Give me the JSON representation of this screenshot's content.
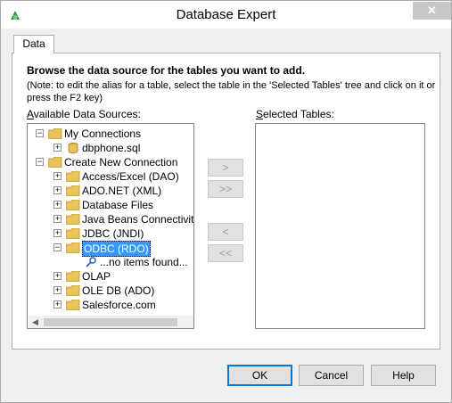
{
  "window": {
    "title": "Database Expert",
    "close_glyph": "✕"
  },
  "tabs": [
    {
      "label": "Data"
    }
  ],
  "heading": "Browse the data source for the tables you want to add.",
  "note": "(Note: to edit the alias for a table, select the table in the 'Selected Tables' tree and click on it or press the F2 key)",
  "available": {
    "label_prefix": "A",
    "label_rest": "vailable Data Sources:"
  },
  "selected": {
    "label_prefix": "S",
    "label_rest": "elected Tables:"
  },
  "tree": {
    "items": [
      {
        "label": "My Connections",
        "expander": "−",
        "icon": "folder-icon"
      },
      {
        "label": "dbphone.sql",
        "expander": "+",
        "icon": "database-icon"
      },
      {
        "label": "Create New Connection",
        "expander": "−",
        "icon": "folder-icon"
      },
      {
        "label": "Access/Excel (DAO)",
        "expander": "+",
        "icon": "folder-icon"
      },
      {
        "label": "ADO.NET (XML)",
        "expander": "+",
        "icon": "folder-icon"
      },
      {
        "label": "Database Files",
        "expander": "+",
        "icon": "folder-icon"
      },
      {
        "label": "Java Beans Connectivit",
        "expander": "+",
        "icon": "folder-icon"
      },
      {
        "label": "JDBC (JNDI)",
        "expander": "+",
        "icon": "folder-icon"
      },
      {
        "label": "ODBC (RDO)",
        "expander": "−",
        "icon": "folder-icon",
        "selected": true
      },
      {
        "label": "...no items found...",
        "expander": "",
        "icon": "search-icon"
      },
      {
        "label": "OLAP",
        "expander": "+",
        "icon": "folder-icon"
      },
      {
        "label": "OLE DB (ADO)",
        "expander": "+",
        "icon": "folder-icon"
      },
      {
        "label": "Salesforce.com",
        "expander": "+",
        "icon": "folder-icon"
      }
    ]
  },
  "move_buttons": {
    "add_one": ">",
    "add_all": ">>",
    "remove_one": "<",
    "remove_all": "<<"
  },
  "buttons": {
    "ok": "OK",
    "cancel": "Cancel",
    "help": "Help"
  },
  "colors": {
    "selection": "#3399ff",
    "folder": "#e8c35a",
    "default_button_border": "#0078d7"
  }
}
